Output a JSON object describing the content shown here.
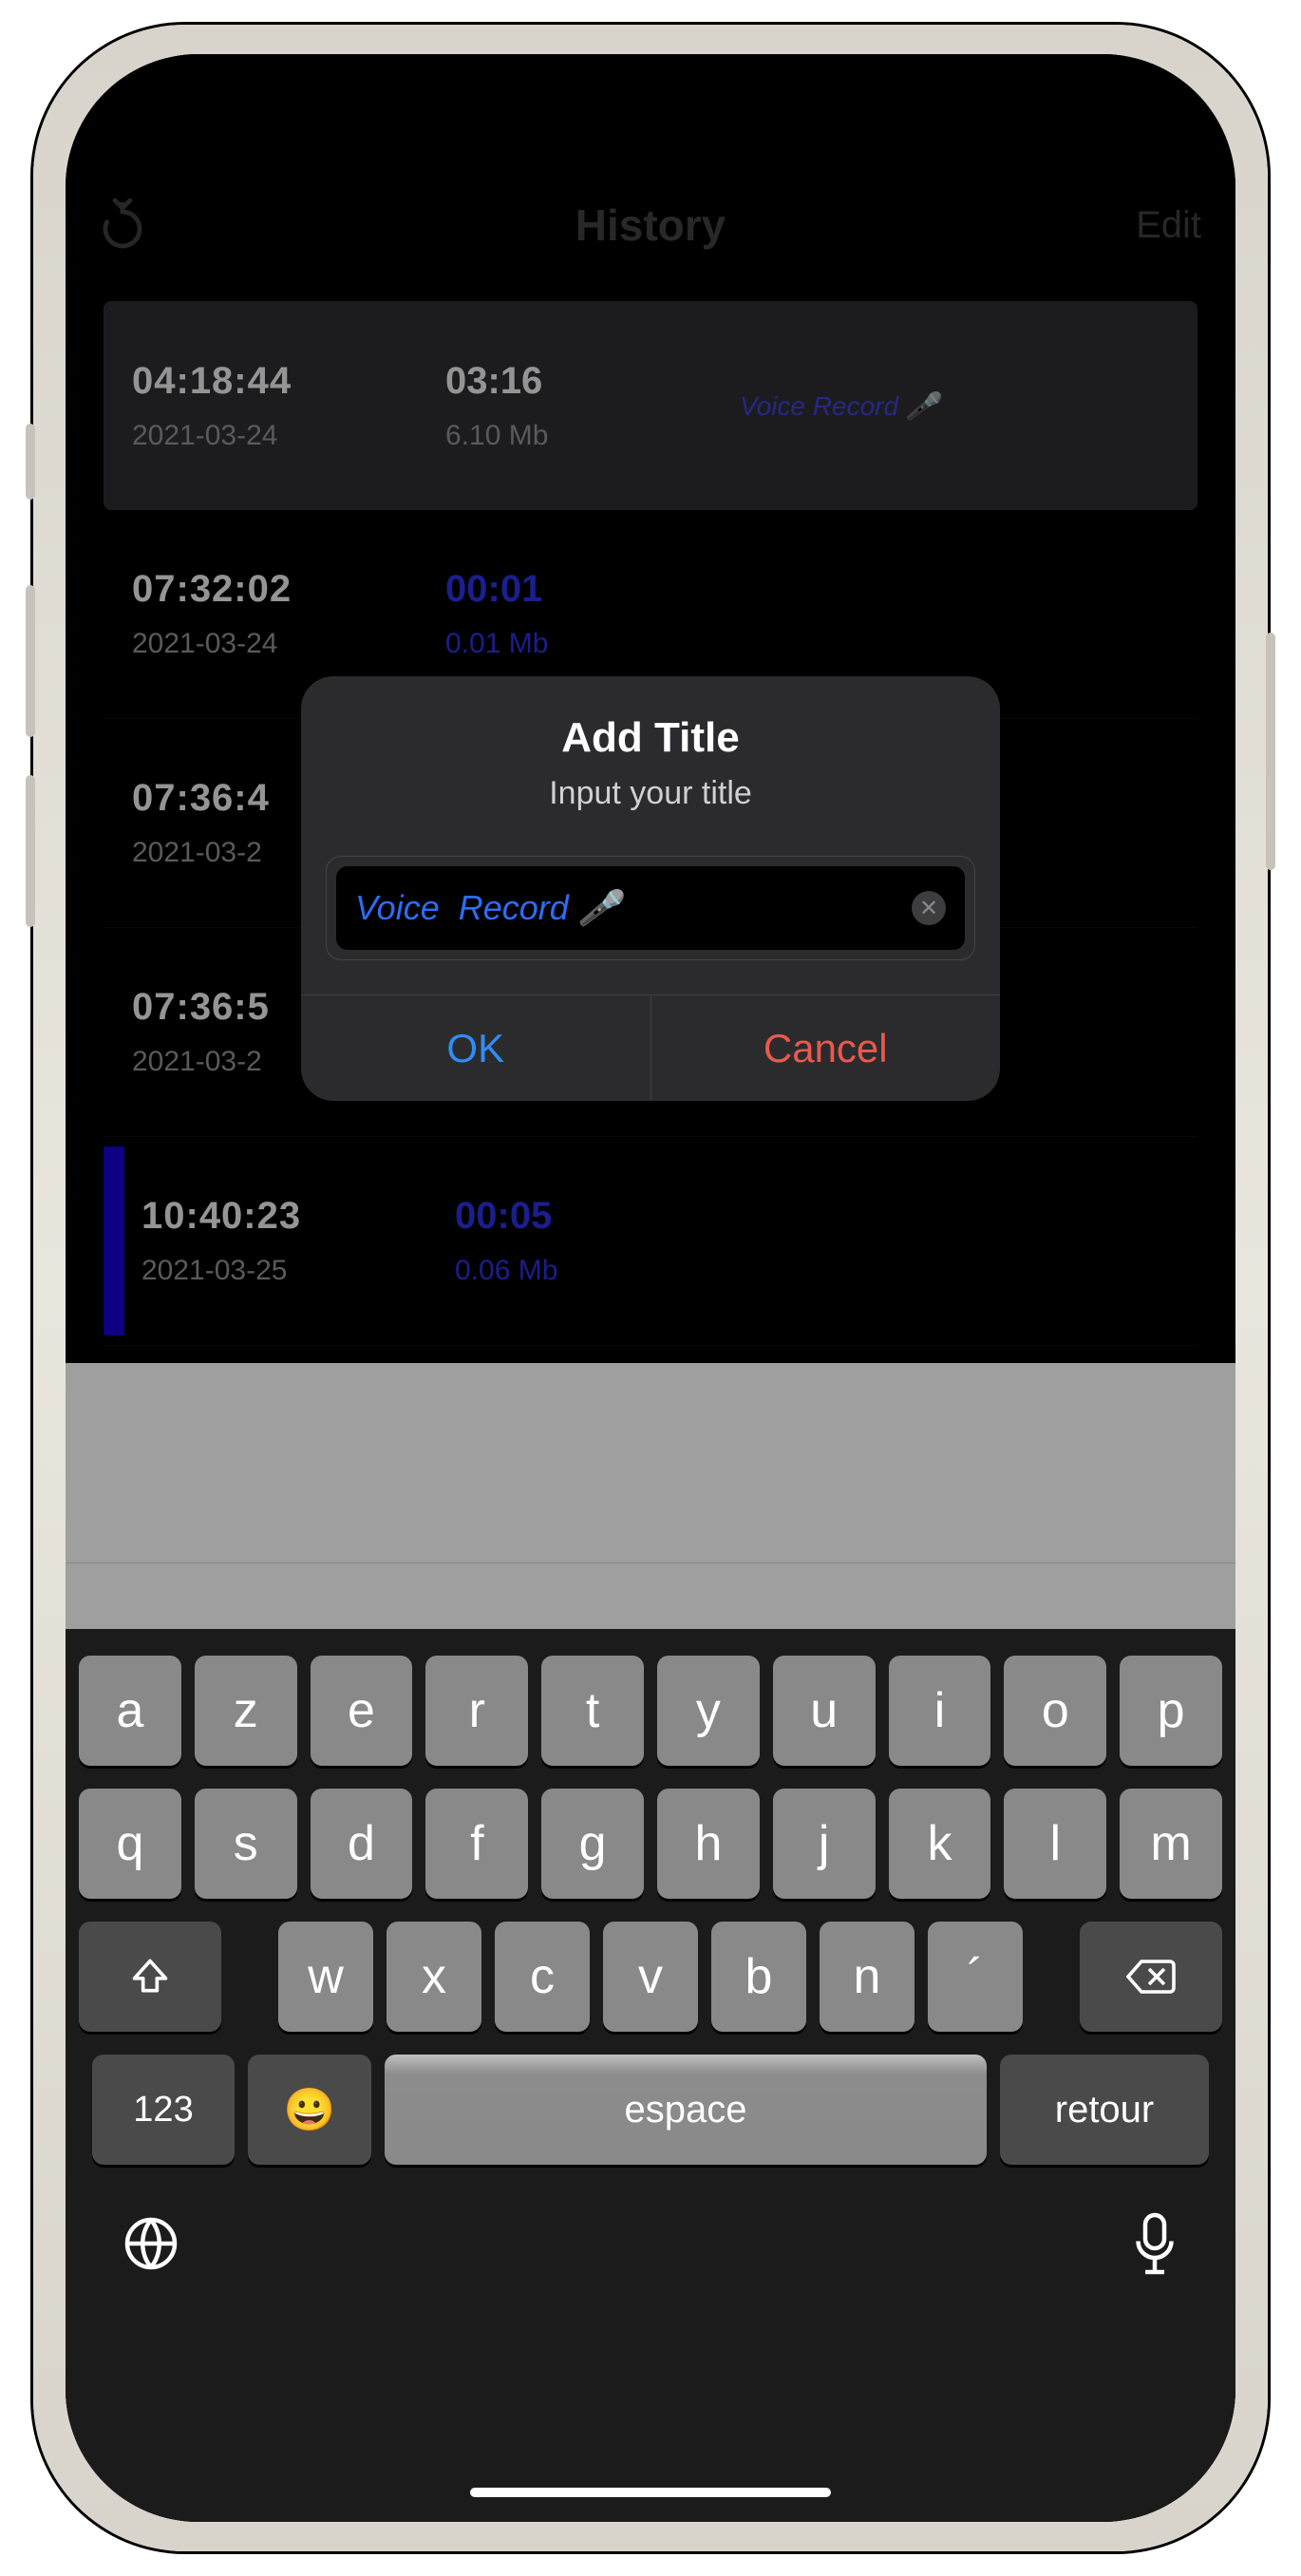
{
  "nav": {
    "title": "History",
    "edit": "Edit"
  },
  "rows": [
    {
      "time": "04:18:44",
      "date": "2021-03-24",
      "dur": "03:16",
      "size": "6.10 Mb",
      "title": "Voice  Record 🎤",
      "dur_blue": false,
      "marked": false
    },
    {
      "time": "07:32:02",
      "date": "2021-03-24",
      "dur": "00:01",
      "size": "0.01 Mb",
      "title": "",
      "dur_blue": true,
      "marked": false
    },
    {
      "time": "07:36:4",
      "date": "2021-03-2",
      "dur": "",
      "size": "",
      "title": "",
      "dur_blue": true,
      "marked": false
    },
    {
      "time": "07:36:5",
      "date": "2021-03-2",
      "dur": "",
      "size": "",
      "title": "",
      "dur_blue": true,
      "marked": false
    },
    {
      "time": "10:40:23",
      "date": "2021-03-25",
      "dur": "00:05",
      "size": "0.06 Mb",
      "title": "",
      "dur_blue": true,
      "marked": true
    }
  ],
  "dialog": {
    "title": "Add Title",
    "subtitle": "Input your title",
    "value": "Voice  Record 🎤",
    "ok": "OK",
    "cancel": "Cancel"
  },
  "keyboard": {
    "row1": [
      "a",
      "z",
      "e",
      "r",
      "t",
      "y",
      "u",
      "i",
      "o",
      "p"
    ],
    "row2": [
      "q",
      "s",
      "d",
      "f",
      "g",
      "h",
      "j",
      "k",
      "l",
      "m"
    ],
    "row3": [
      "w",
      "x",
      "c",
      "v",
      "b",
      "n",
      "´"
    ],
    "num": "123",
    "space": "espace",
    "ret": "retour",
    "emoji": "😀"
  }
}
